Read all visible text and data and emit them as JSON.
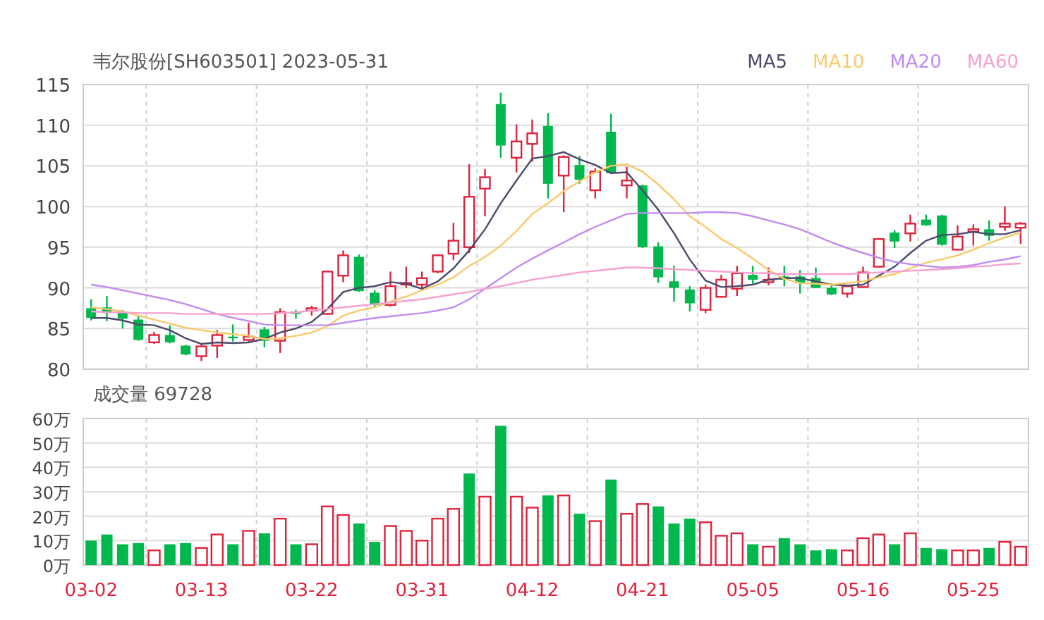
{
  "header": {
    "title": "韦尔股份[SH603501] 2023-05-31"
  },
  "price_chart": {
    "chart_data": {
      "type": "candlestick",
      "grid": true,
      "ylim": [
        80,
        115
      ],
      "yticks": [
        80,
        85,
        90,
        95,
        100,
        105,
        110,
        115
      ],
      "ohlc": [
        [
          87.5,
          88.6,
          86.0,
          86.3
        ],
        [
          87.6,
          89.0,
          85.9,
          86.9
        ],
        [
          87.0,
          87.3,
          85.0,
          86.2
        ],
        [
          86.1,
          86.6,
          83.5,
          83.6
        ],
        [
          83.3,
          84.6,
          83.1,
          84.2
        ],
        [
          84.2,
          85.4,
          83.2,
          83.3
        ],
        [
          82.9,
          83.0,
          81.7,
          81.8
        ],
        [
          81.6,
          83.1,
          81.0,
          82.8
        ],
        [
          82.9,
          84.8,
          81.4,
          84.2
        ],
        [
          84.0,
          85.5,
          83.4,
          83.8
        ],
        [
          83.6,
          85.7,
          83.4,
          84.0
        ],
        [
          84.9,
          85.2,
          82.7,
          83.5
        ],
        [
          83.5,
          87.5,
          82.0,
          87.0
        ],
        [
          87.1,
          87.3,
          86.2,
          86.8
        ],
        [
          87.2,
          87.8,
          86.6,
          87.5
        ],
        [
          86.8,
          92.1,
          86.7,
          92.0
        ],
        [
          91.5,
          94.6,
          90.7,
          94.0
        ],
        [
          93.8,
          94.1,
          89.5,
          89.6
        ],
        [
          89.4,
          89.7,
          87.7,
          87.9
        ],
        [
          87.9,
          92.0,
          87.7,
          90.2
        ],
        [
          90.4,
          92.6,
          90.0,
          90.6
        ],
        [
          90.4,
          92.0,
          89.8,
          91.2
        ],
        [
          92.0,
          94.1,
          91.8,
          94.0
        ],
        [
          94.2,
          98.0,
          93.4,
          95.8
        ],
        [
          95.0,
          105.2,
          94.3,
          101.2
        ],
        [
          102.2,
          104.6,
          98.8,
          103.6
        ],
        [
          112.6,
          114.0,
          106.0,
          107.5
        ],
        [
          106.0,
          110.1,
          104.2,
          108.0
        ],
        [
          107.7,
          110.7,
          105.5,
          109.0
        ],
        [
          109.9,
          111.5,
          101.0,
          102.8
        ],
        [
          103.8,
          106.3,
          99.3,
          106.1
        ],
        [
          105.1,
          106.2,
          102.8,
          103.3
        ],
        [
          102.0,
          104.7,
          101.0,
          104.3
        ],
        [
          109.2,
          111.4,
          104.0,
          104.1
        ],
        [
          102.6,
          104.9,
          101.0,
          103.2
        ],
        [
          102.6,
          102.7,
          94.9,
          95.0
        ],
        [
          95.1,
          95.6,
          90.6,
          91.3
        ],
        [
          90.8,
          92.7,
          88.3,
          90.0
        ],
        [
          89.8,
          90.2,
          87.1,
          88.1
        ],
        [
          87.3,
          90.4,
          86.9,
          90.0
        ],
        [
          88.9,
          91.6,
          88.8,
          91.0
        ],
        [
          89.9,
          92.7,
          89.0,
          91.8
        ],
        [
          91.6,
          92.7,
          90.5,
          91.0
        ],
        [
          90.7,
          92.5,
          90.3,
          91.0
        ],
        [
          91.4,
          92.7,
          90.2,
          91.0
        ],
        [
          91.4,
          92.2,
          89.3,
          90.6
        ],
        [
          91.2,
          92.5,
          90.0,
          90.0
        ],
        [
          90.0,
          90.5,
          89.1,
          89.2
        ],
        [
          89.3,
          90.3,
          88.8,
          90.2
        ],
        [
          90.1,
          92.6,
          90.0,
          91.9
        ],
        [
          92.6,
          96.1,
          92.5,
          96.0
        ],
        [
          96.8,
          97.1,
          94.9,
          95.7
        ],
        [
          96.7,
          99.0,
          95.7,
          97.9
        ],
        [
          98.4,
          99.0,
          97.6,
          97.7
        ],
        [
          98.9,
          99.0,
          95.2,
          95.3
        ],
        [
          94.7,
          97.7,
          94.6,
          96.3
        ],
        [
          96.9,
          97.8,
          95.2,
          97.2
        ],
        [
          97.2,
          98.3,
          95.8,
          96.4
        ],
        [
          97.5,
          100.0,
          97.0,
          97.9
        ],
        [
          97.4,
          98.1,
          95.4,
          97.9
        ]
      ],
      "series": [
        {
          "name": "MA5",
          "type": "line",
          "color": "#4b4a6a",
          "values": [
            86.3,
            86.3,
            86.0,
            85.5,
            85.4,
            84.8,
            83.8,
            83.1,
            83.3,
            83.2,
            83.3,
            83.7,
            84.5,
            85.0,
            85.8,
            87.4,
            89.5,
            90.0,
            90.2,
            90.7,
            90.5,
            89.9,
            90.8,
            92.4,
            94.6,
            97.2,
            100.4,
            103.2,
            105.9,
            106.2,
            106.7,
            105.8,
            105.1,
            104.1,
            104.2,
            102.0,
            99.6,
            96.7,
            93.5,
            90.9,
            90.1,
            90.2,
            90.4,
            91.0,
            91.2,
            91.2,
            90.8,
            90.4,
            90.3,
            90.4,
            91.5,
            92.6,
            94.3,
            95.8,
            96.5,
            96.6,
            96.9,
            96.6,
            96.6,
            97.1
          ]
        },
        {
          "name": "MA10",
          "type": "line",
          "color": "#f9c96a",
          "values": [
            87.6,
            87.4,
            87.1,
            86.6,
            86.1,
            85.6,
            85.1,
            84.8,
            84.5,
            84.3,
            84.1,
            83.7,
            83.8,
            84.1,
            84.5,
            85.3,
            86.6,
            87.2,
            87.6,
            88.3,
            88.9,
            89.7,
            90.4,
            91.3,
            92.7,
            93.8,
            95.2,
            97.0,
            99.1,
            100.4,
            101.9,
            103.1,
            104.2,
            105.0,
            105.2,
            104.3,
            102.7,
            100.9,
            98.8,
            97.5,
            96.0,
            94.9,
            93.6,
            92.2,
            91.1,
            90.6,
            90.5,
            90.4,
            90.6,
            90.8,
            91.3,
            91.7,
            92.4,
            93.1,
            93.5,
            94.0,
            94.7,
            95.5,
            96.2,
            96.8
          ]
        },
        {
          "name": "MA20",
          "type": "line",
          "color": "#c08cf0",
          "values": [
            90.4,
            90.1,
            89.7,
            89.3,
            88.9,
            88.5,
            88.0,
            87.4,
            86.8,
            86.3,
            85.9,
            85.5,
            85.4,
            85.4,
            85.4,
            85.4,
            85.7,
            86.0,
            86.3,
            86.5,
            86.7,
            86.9,
            87.2,
            87.6,
            88.6,
            89.9,
            91.2,
            92.5,
            93.6,
            94.6,
            95.6,
            96.6,
            97.5,
            98.3,
            99.1,
            99.2,
            99.2,
            99.2,
            99.2,
            99.3,
            99.3,
            99.2,
            98.8,
            98.3,
            97.8,
            97.2,
            96.4,
            95.6,
            94.9,
            94.3,
            93.7,
            93.2,
            92.9,
            92.7,
            92.5,
            92.6,
            92.8,
            93.2,
            93.5,
            93.9
          ]
        },
        {
          "name": "MA60",
          "type": "line",
          "color": "#f7a0d0",
          "values": [
            87.1,
            87.0,
            87.0,
            86.9,
            86.9,
            86.9,
            86.8,
            86.8,
            86.8,
            86.8,
            86.8,
            86.8,
            86.9,
            87.0,
            87.2,
            87.4,
            87.6,
            87.8,
            88.0,
            88.2,
            88.4,
            88.6,
            88.9,
            89.2,
            89.5,
            89.9,
            90.2,
            90.6,
            91.0,
            91.3,
            91.6,
            91.9,
            92.1,
            92.3,
            92.5,
            92.5,
            92.4,
            92.3,
            92.2,
            92.1,
            92.0,
            91.9,
            91.8,
            91.8,
            91.7,
            91.7,
            91.7,
            91.7,
            91.7,
            91.8,
            91.9,
            92.0,
            92.1,
            92.2,
            92.3,
            92.4,
            92.6,
            92.7,
            92.9,
            93.0
          ]
        }
      ]
    }
  },
  "volume_chart": {
    "title": "成交量 69728",
    "chart_data": {
      "type": "bar",
      "grid": true,
      "stacked": true,
      "ylim": [
        0,
        60
      ],
      "yticks": [
        {
          "value": 0,
          "label": "0万"
        },
        {
          "value": 10,
          "label": "10万"
        },
        {
          "value": 20,
          "label": "20万"
        },
        {
          "value": 30,
          "label": "30万"
        },
        {
          "value": 40,
          "label": "40万"
        },
        {
          "value": 50,
          "label": "50万"
        },
        {
          "value": 60,
          "label": "60万"
        }
      ],
      "categories": [
        "03-02",
        null,
        null,
        null,
        null,
        null,
        null,
        "03-13",
        null,
        null,
        null,
        null,
        null,
        null,
        "03-22",
        null,
        null,
        null,
        null,
        null,
        null,
        "03-31",
        null,
        null,
        null,
        null,
        null,
        null,
        "04-12",
        null,
        null,
        null,
        null,
        null,
        null,
        "04-21",
        null,
        null,
        null,
        null,
        null,
        null,
        "05-05",
        null,
        null,
        null,
        null,
        null,
        null,
        "05-16",
        null,
        null,
        null,
        null,
        null,
        null,
        "05-25",
        null,
        null,
        null
      ],
      "series": [
        {
          "color": "#e0223c",
          "values": [
            null,
            null,
            null,
            null,
            6,
            null,
            null,
            7,
            12.5,
            null,
            14,
            null,
            19,
            null,
            8.5,
            24,
            20.5,
            null,
            null,
            16,
            14,
            10,
            19,
            23,
            null,
            28,
            null,
            28,
            23.5,
            null,
            28.5,
            null,
            18,
            null,
            21,
            25,
            null,
            null,
            null,
            17.5,
            12,
            13,
            null,
            7.5,
            null,
            null,
            null,
            null,
            6,
            11,
            12.5,
            null,
            13,
            null,
            null,
            6,
            6,
            null,
            9.5,
            7.5
          ]
        },
        {
          "color": "#00b84d",
          "values": [
            10,
            12.5,
            8.5,
            9,
            null,
            8.5,
            9,
            null,
            null,
            8.5,
            null,
            13,
            null,
            8.5,
            null,
            null,
            null,
            17,
            9.5,
            null,
            null,
            null,
            null,
            null,
            37.5,
            null,
            57,
            null,
            null,
            28.5,
            null,
            21,
            null,
            35,
            null,
            null,
            24,
            17,
            19,
            null,
            null,
            null,
            8.5,
            null,
            11,
            8.5,
            6,
            6.5,
            null,
            null,
            null,
            8.5,
            null,
            7,
            6.5,
            null,
            null,
            7,
            null,
            null
          ]
        }
      ]
    }
  }
}
